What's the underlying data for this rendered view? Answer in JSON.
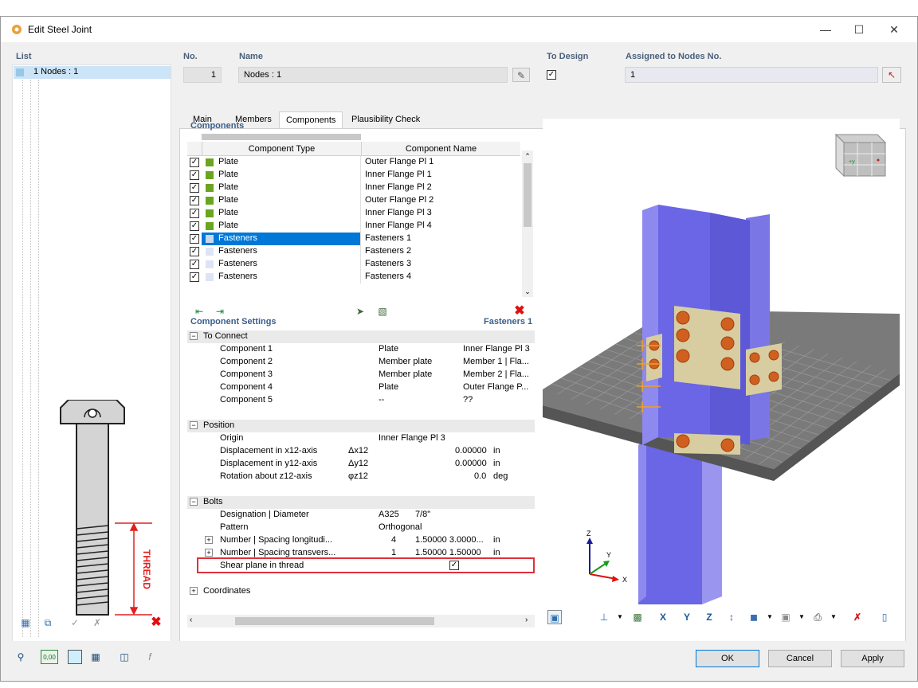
{
  "window": {
    "title": "Edit Steel Joint"
  },
  "list": {
    "label": "List",
    "items": [
      {
        "label": "1  Nodes : 1"
      }
    ]
  },
  "header": {
    "no_label": "No.",
    "no_value": "1",
    "name_label": "Name",
    "name_value": "Nodes : 1",
    "to_design_label": "To Design",
    "assigned_label": "Assigned to Nodes No.",
    "assigned_value": "1"
  },
  "tabs": [
    {
      "label": "Main"
    },
    {
      "label": "Members"
    },
    {
      "label": "Components"
    },
    {
      "label": "Plausibility Check"
    }
  ],
  "components": {
    "title": "Components",
    "col_type": "Component Type",
    "col_name": "Component Name",
    "rows": [
      {
        "type": "Plate",
        "name": "Outer Flange Pl 1",
        "color": "#6aa51f"
      },
      {
        "type": "Plate",
        "name": "Inner Flange Pl 1",
        "color": "#6aa51f"
      },
      {
        "type": "Plate",
        "name": "Inner Flange Pl 2",
        "color": "#6aa51f"
      },
      {
        "type": "Plate",
        "name": "Outer Flange Pl 2",
        "color": "#6aa51f"
      },
      {
        "type": "Plate",
        "name": "Inner Flange Pl 3",
        "color": "#6aa51f"
      },
      {
        "type": "Plate",
        "name": "Inner Flange Pl 4",
        "color": "#6aa51f"
      },
      {
        "type": "Fasteners",
        "name": "Fasteners 1",
        "color": "#c8d8f0"
      },
      {
        "type": "Fasteners",
        "name": "Fasteners 2",
        "color": "#dde4f5"
      },
      {
        "type": "Fasteners",
        "name": "Fasteners 3",
        "color": "#dde4f5"
      },
      {
        "type": "Fasteners",
        "name": "Fasteners 4",
        "color": "#dde4f5"
      }
    ]
  },
  "settings": {
    "title": "Component Settings",
    "current": "Fasteners 1",
    "to_connect": {
      "label": "To Connect",
      "rows": [
        {
          "name": "Component 1",
          "type": "Plate",
          "value": "Inner Flange Pl 3"
        },
        {
          "name": "Component 2",
          "type": "Member plate",
          "value": "Member 1 | Fla..."
        },
        {
          "name": "Component 3",
          "type": "Member plate",
          "value": "Member 2 | Fla..."
        },
        {
          "name": "Component 4",
          "type": "Plate",
          "value": "Outer Flange P..."
        },
        {
          "name": "Component 5",
          "type": "--",
          "value": "??"
        }
      ]
    },
    "position": {
      "label": "Position",
      "origin_label": "Origin",
      "origin_value": "Inner Flange Pl 3",
      "dx_label": "Displacement in x12-axis",
      "dx_sym": "Δx12",
      "dx_value": "0.00000",
      "dx_unit": "in",
      "dy_label": "Displacement in y12-axis",
      "dy_sym": "Δy12",
      "dy_value": "0.00000",
      "dy_unit": "in",
      "rz_label": "Rotation about z12-axis",
      "rz_sym": "φz12",
      "rz_value": "0.0",
      "rz_unit": "deg"
    },
    "bolts": {
      "label": "Bolts",
      "designation_label": "Designation | Diameter",
      "designation_grade": "A325",
      "designation_diameter": "7/8\"",
      "pattern_label": "Pattern",
      "pattern_value": "Orthogonal",
      "num_long_label": "Number | Spacing longitudi...",
      "num_long_count": "4",
      "num_long_spacing": "1.50000 3.0000...",
      "num_long_unit": "in",
      "num_trans_label": "Number | Spacing transvers...",
      "num_trans_count": "1",
      "num_trans_spacing": "1.50000 1.50000",
      "num_trans_unit": "in",
      "shear_label": "Shear plane in thread"
    },
    "coordinates": {
      "label": "Coordinates"
    }
  },
  "bolt_drawing": {
    "thread_label": "THREAD"
  },
  "axes": {
    "z": "Z",
    "y": "Y",
    "x": "X"
  },
  "view_cube": {
    "face_label": "+y"
  },
  "footer": {
    "ok": "OK",
    "cancel": "Cancel",
    "apply": "Apply",
    "zero_value": "0,00"
  }
}
